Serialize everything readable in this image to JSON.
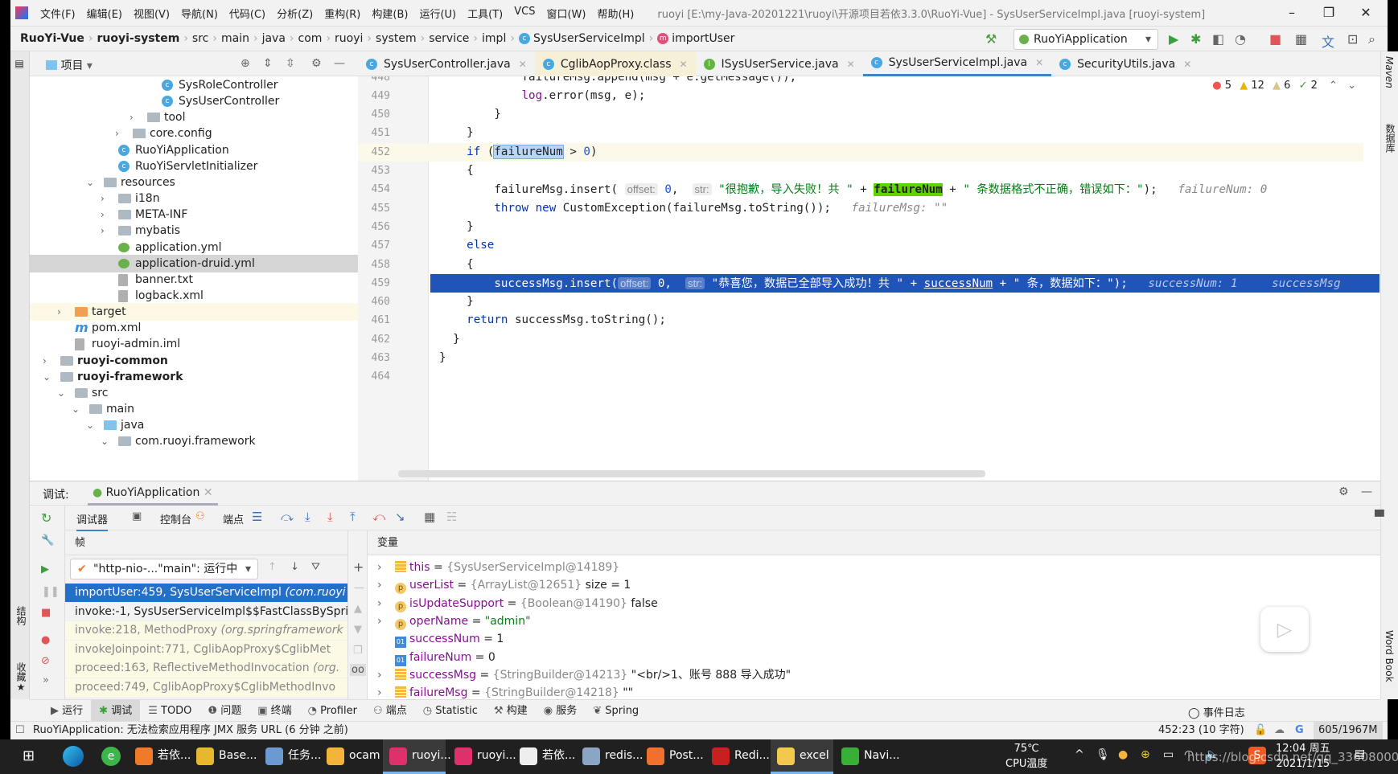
{
  "menu": [
    "文件(F)",
    "编辑(E)",
    "视图(V)",
    "导航(N)",
    "代码(C)",
    "分析(Z)",
    "重构(R)",
    "构建(B)",
    "运行(U)",
    "工具(T)",
    "VCS",
    "窗口(W)",
    "帮助(H)"
  ],
  "window_title": "ruoyi [E:\\my-Java-20201221\\ruoyi\\开源项目若依3.3.0\\RuoYi-Vue] - SysUserServiceImpl.java [ruoyi-system]",
  "breadcrumb": [
    {
      "t": "RuoYi-Vue",
      "b": true
    },
    {
      "t": "ruoyi-system",
      "b": true
    },
    {
      "t": "src"
    },
    {
      "t": "main"
    },
    {
      "t": "java"
    },
    {
      "t": "com"
    },
    {
      "t": "ruoyi"
    },
    {
      "t": "system"
    },
    {
      "t": "service"
    },
    {
      "t": "impl"
    },
    {
      "t": "SysUserServiceImpl",
      "icon": "c"
    },
    {
      "t": "importUser",
      "icon": "m"
    }
  ],
  "run_config": "RuoYiApplication",
  "project_panel": {
    "title": "项目"
  },
  "tree": [
    {
      "label": "SysRoleController",
      "depth": 9,
      "icon": "cls"
    },
    {
      "label": "SysUserController",
      "depth": 9,
      "icon": "cls"
    },
    {
      "label": "tool",
      "depth": 8,
      "icon": "folder",
      "arrow": "›"
    },
    {
      "label": "core.config",
      "depth": 7,
      "icon": "folder",
      "arrow": "›"
    },
    {
      "label": "RuoYiApplication",
      "depth": 6,
      "icon": "cls"
    },
    {
      "label": "RuoYiServletInitializer",
      "depth": 6,
      "icon": "cls"
    },
    {
      "label": "resources",
      "depth": 5,
      "icon": "folder",
      "arrow": "⌄"
    },
    {
      "label": "i18n",
      "depth": 6,
      "icon": "folder",
      "arrow": "›"
    },
    {
      "label": "META-INF",
      "depth": 6,
      "icon": "folder",
      "arrow": "›"
    },
    {
      "label": "mybatis",
      "depth": 6,
      "icon": "folder",
      "arrow": "›"
    },
    {
      "label": "application.yml",
      "depth": 6,
      "icon": "yml"
    },
    {
      "label": "application-druid.yml",
      "depth": 6,
      "icon": "yml",
      "selected": true
    },
    {
      "label": "banner.txt",
      "depth": 6,
      "icon": "file"
    },
    {
      "label": "logback.xml",
      "depth": 6,
      "icon": "file"
    },
    {
      "label": "target",
      "depth": 3,
      "icon": "orange",
      "arrow": "›",
      "target": true
    },
    {
      "label": "pom.xml",
      "depth": 3,
      "icon": "mvn"
    },
    {
      "label": "ruoyi-admin.iml",
      "depth": 3,
      "icon": "file"
    },
    {
      "label": "ruoyi-common",
      "depth": 2,
      "icon": "folder",
      "arrow": "›",
      "bold": true
    },
    {
      "label": "ruoyi-framework",
      "depth": 2,
      "icon": "folder",
      "arrow": "⌄",
      "bold": true
    },
    {
      "label": "src",
      "depth": 3,
      "icon": "folder",
      "arrow": "⌄"
    },
    {
      "label": "main",
      "depth": 4,
      "icon": "folder",
      "arrow": "⌄"
    },
    {
      "label": "java",
      "depth": 5,
      "icon": "blue",
      "arrow": "⌄"
    },
    {
      "label": "com.ruoyi.framework",
      "depth": 6,
      "icon": "folder",
      "arrow": "⌄"
    }
  ],
  "tabs": [
    {
      "label": "SysUserController.java",
      "icon": "c"
    },
    {
      "label": "CglibAopProxy.class",
      "icon": "c",
      "style": "yellowtab"
    },
    {
      "label": "ISysUserService.java",
      "icon": "i"
    },
    {
      "label": "SysUserServiceImpl.java",
      "icon": "c",
      "active": true
    },
    {
      "label": "SecurityUtils.java",
      "icon": "c"
    }
  ],
  "inspections": {
    "errors": "5",
    "warnings": "12",
    "weak_warnings": "6",
    "ok": "2"
  },
  "code": [
    {
      "n": "448",
      "tokens": [
        [
          "            failureMsg.append(msg + e.getMessage());",
          ""
        ]
      ]
    },
    {
      "n": "449",
      "tokens": [
        [
          "            ",
          ""
        ],
        [
          "log",
          "fld"
        ],
        [
          ".error(msg, e);",
          ""
        ]
      ]
    },
    {
      "n": "450",
      "tokens": [
        [
          "        }",
          ""
        ]
      ]
    },
    {
      "n": "451",
      "tokens": [
        [
          "    }",
          ""
        ]
      ]
    },
    {
      "n": "452",
      "caret": true,
      "tokens": [
        [
          "    ",
          ""
        ],
        [
          "if",
          "kw"
        ],
        [
          " (",
          ""
        ],
        [
          "failureNum",
          "selhl"
        ],
        [
          " > ",
          ""
        ],
        [
          "0",
          "num"
        ],
        [
          ")",
          ""
        ]
      ]
    },
    {
      "n": "453",
      "tokens": [
        [
          "    {",
          ""
        ]
      ]
    },
    {
      "n": "454",
      "tokens": [
        [
          "        failureMsg.insert( ",
          ""
        ],
        [
          "offset:",
          "hintbox"
        ],
        [
          " ",
          ""
        ],
        [
          "0",
          "num"
        ],
        [
          ",  ",
          ""
        ],
        [
          "str:",
          "hintbox"
        ],
        [
          " ",
          ""
        ],
        [
          "\"很抱歉，导入失败！共 \"",
          "str"
        ],
        [
          " + ",
          ""
        ],
        [
          "failureNum",
          "grnhl"
        ],
        [
          " + ",
          ""
        ],
        [
          "\" 条数据格式不正确，错误如下：\"",
          "str"
        ],
        [
          ");   ",
          ""
        ],
        [
          "failureNum: 0",
          "inl"
        ]
      ]
    },
    {
      "n": "455",
      "tokens": [
        [
          "        ",
          ""
        ],
        [
          "throw",
          "kw"
        ],
        [
          " ",
          ""
        ],
        [
          "new",
          "kw"
        ],
        [
          " CustomException(failureMsg.toString());   ",
          ""
        ],
        [
          "failureMsg: \"\"",
          "inl"
        ]
      ]
    },
    {
      "n": "456",
      "tokens": [
        [
          "    }",
          ""
        ]
      ]
    },
    {
      "n": "457",
      "tokens": [
        [
          "    ",
          ""
        ],
        [
          "else",
          "kw"
        ]
      ]
    },
    {
      "n": "458",
      "tokens": [
        [
          "    {",
          ""
        ]
      ]
    },
    {
      "n": "459",
      "exec": true,
      "tokens": [
        [
          "        successMsg.insert(",
          ""
        ],
        [
          "offset:",
          "hintbox"
        ],
        [
          " 0,  ",
          ""
        ],
        [
          "str:",
          "hintbox"
        ],
        [
          " \"恭喜您，数据已全部导入成功！共 \" + ",
          ""
        ],
        [
          "successNum",
          "uline"
        ],
        [
          " + \" 条，数据如下：\");   ",
          ""
        ],
        [
          "successNum: 1",
          "inl"
        ],
        [
          "     ",
          ""
        ],
        [
          "successMsg",
          "inl"
        ]
      ]
    },
    {
      "n": "460",
      "tokens": [
        [
          "    }",
          ""
        ]
      ]
    },
    {
      "n": "461",
      "tokens": [
        [
          "    ",
          ""
        ],
        [
          "return",
          "kw"
        ],
        [
          " successMsg.toString();",
          ""
        ]
      ]
    },
    {
      "n": "462",
      "tokens": [
        [
          "  }",
          ""
        ]
      ]
    },
    {
      "n": "463",
      "tokens": [
        [
          "}",
          ""
        ]
      ]
    },
    {
      "n": "464",
      "tokens": []
    }
  ],
  "right_strip": {
    "maven": "Maven",
    "database": "数据库",
    "wordbook": "Word Book"
  },
  "debug": {
    "label": "调试:",
    "session": "RuoYiApplication",
    "tabs": [
      "调试器",
      "控制台",
      "端点"
    ],
    "frames_title": "帧",
    "thread": "\"http-nio-...\"main\": 运行中",
    "frames": [
      {
        "text": "importUser:459, SysUserServiceImpl ",
        "pkg": "(com.ruoyi",
        "style": "sel"
      },
      {
        "text": "invoke:-1, SysUserServiceImpl$$FastClassBySpri",
        "pkg": "",
        "style": ""
      },
      {
        "text": "invoke:218, MethodProxy ",
        "pkg": "(org.springframework",
        "style": "lib"
      },
      {
        "text": "invokeJoinpoint:771, CglibAopProxy$CglibMet",
        "pkg": "",
        "style": "lib"
      },
      {
        "text": "proceed:163, ReflectiveMethodInvocation ",
        "pkg": "(org.",
        "style": "lib"
      },
      {
        "text": "proceed:749, CglibAopProxy$CglibMethodInvo",
        "pkg": "",
        "style": "lib"
      }
    ],
    "vars_title": "变量",
    "vars": [
      {
        "name": "this",
        "type": "{SysUserServiceImpl@14189}",
        "value": "",
        "icon": "bar",
        "expand": true
      },
      {
        "name": "userList",
        "type": "{ArrayList@12651}",
        "value": " size = 1",
        "icon": "p",
        "expand": true
      },
      {
        "name": "isUpdateSupport",
        "type": "{Boolean@14190}",
        "value": " false",
        "icon": "p",
        "expand": true
      },
      {
        "name": "operName",
        "type": "",
        "value": "\"admin\"",
        "icon": "p",
        "expand": true,
        "str": true
      },
      {
        "name": "successNum",
        "type": "",
        "value": "1",
        "icon": "prim"
      },
      {
        "name": "failureNum",
        "type": "",
        "value": "0",
        "icon": "prim"
      },
      {
        "name": "successMsg",
        "type": "{StringBuilder@14213}",
        "value": " \"<br/>1、账号 888 导入成功\"",
        "icon": "bar",
        "expand": true
      },
      {
        "name": "failureMsg",
        "type": "{StringBuilder@14218}",
        "value": " \"\"",
        "icon": "bar",
        "expand": true
      }
    ]
  },
  "toolwindows": [
    "运行",
    "调试",
    "TODO",
    "问题",
    "终端",
    "Profiler",
    "端点",
    "Statistic",
    "构建",
    "服务",
    "Spring"
  ],
  "event_log": "事件日志",
  "status": {
    "message": "RuoYiApplication: 无法检索应用程序 JMX 服务 URL (6 分钟 之前)",
    "position": "452:23 (10 字符)",
    "memory": "605/1967M"
  },
  "taskbar": {
    "items": [
      {
        "label": "若依...",
        "color": "#f07a2a"
      },
      {
        "label": "Base...",
        "color": "#e8b82c"
      },
      {
        "label": "任务...",
        "color": "#6a9ad0"
      },
      {
        "label": "ocam",
        "color": "#f2b53a"
      },
      {
        "label": "ruoyi...",
        "color": "#e0306a",
        "on": true
      },
      {
        "label": "ruoyi...",
        "color": "#e0306a"
      },
      {
        "label": "若依...",
        "color": "#eeeeee"
      },
      {
        "label": "redis...",
        "color": "#8aa6c4"
      },
      {
        "label": "Post...",
        "color": "#f2702e"
      },
      {
        "label": "Redi...",
        "color": "#c82020"
      },
      {
        "label": "excel",
        "color": "#f2c94c",
        "on": true
      },
      {
        "label": "Navi...",
        "color": "#38b038"
      }
    ],
    "temp": "75℃",
    "temp_label": "CPU温度",
    "time": "12:04 周五",
    "date": "2021/1/15",
    "watermark": "https://blog.csdn.net/qq_33608000"
  }
}
